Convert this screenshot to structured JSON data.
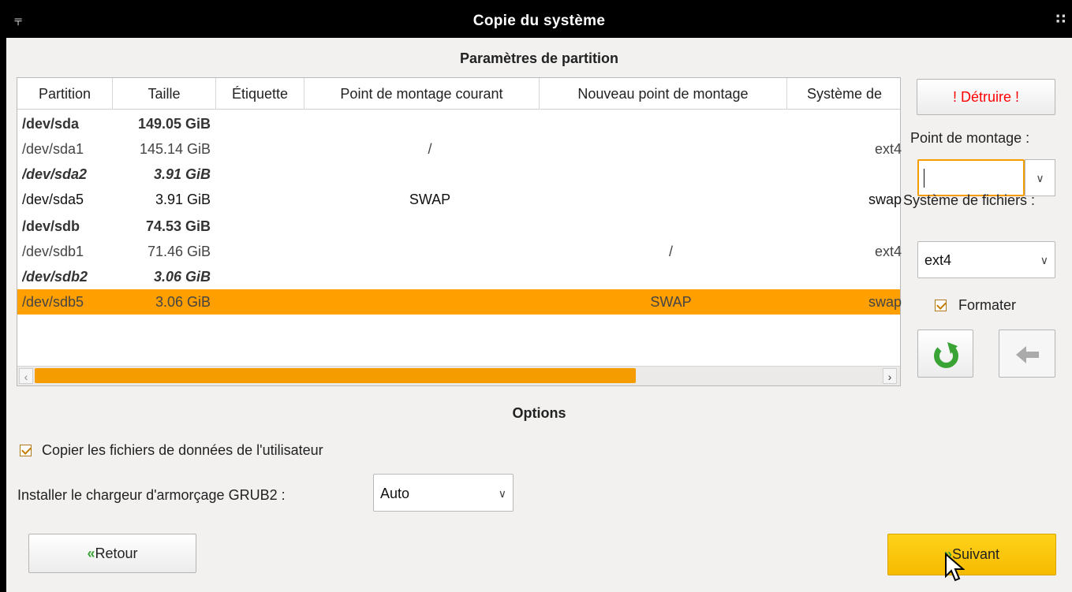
{
  "window": {
    "title": "Copie du système"
  },
  "partition_section": {
    "title": "Paramètres de partition",
    "columns": [
      "Partition",
      "Taille",
      "Étiquette",
      "Point de montage courant",
      "Nouveau point de montage",
      "Système de"
    ],
    "rows": [
      {
        "partition": "/dev/sda",
        "size": "149.05 GiB",
        "label": "",
        "current_mount": "",
        "new_mount": "",
        "fs": "",
        "style": "disk"
      },
      {
        "partition": "/dev/sda1",
        "size": "145.14 GiB",
        "label": "",
        "current_mount": "/",
        "new_mount": "",
        "fs": "ext4",
        "style": "normal-grey"
      },
      {
        "partition": "/dev/sda2",
        "size": "3.91 GiB",
        "label": "",
        "current_mount": "",
        "new_mount": "",
        "fs": "",
        "style": "ext"
      },
      {
        "partition": "/dev/sda5",
        "size": "3.91 GiB",
        "label": "",
        "current_mount": "SWAP",
        "new_mount": "",
        "fs": "swap",
        "style": "normal"
      },
      {
        "partition": "/dev/sdb",
        "size": "74.53 GiB",
        "label": "",
        "current_mount": "",
        "new_mount": "",
        "fs": "",
        "style": "disk"
      },
      {
        "partition": "/dev/sdb1",
        "size": "71.46 GiB",
        "label": "",
        "current_mount": "",
        "new_mount": "/",
        "fs": "ext4",
        "style": "normal-grey"
      },
      {
        "partition": "/dev/sdb2",
        "size": "3.06 GiB",
        "label": "",
        "current_mount": "",
        "new_mount": "",
        "fs": "",
        "style": "ext"
      },
      {
        "partition": "/dev/sdb5",
        "size": "3.06 GiB",
        "label": "",
        "current_mount": "",
        "new_mount": "SWAP",
        "fs": "swap",
        "style": "selected"
      }
    ]
  },
  "side_panel": {
    "destroy_label": "! Détruire !",
    "mount_point_label": "Point de montage :",
    "mount_point_value": "",
    "filesystem_label": "Système de fichiers :",
    "filesystem_value": "ext4",
    "format_label": "Formater",
    "format_checked": true,
    "refresh_icon": "refresh-icon",
    "back_arrow_icon": "arrow-left-icon"
  },
  "options": {
    "title": "Options",
    "copy_user_files_label": "Copier les fichiers de données de l'utilisateur",
    "copy_user_files_checked": true,
    "grub_label": "Installer le chargeur d'armorçage GRUB2 :",
    "grub_value": "Auto"
  },
  "footer": {
    "back_label": "Retour",
    "next_label": "Suivant"
  },
  "colors": {
    "selection": "#ff9f00",
    "next_button": "#f8c000",
    "destroy_text": "#ff0000",
    "refresh_icon": "#3aa335"
  }
}
